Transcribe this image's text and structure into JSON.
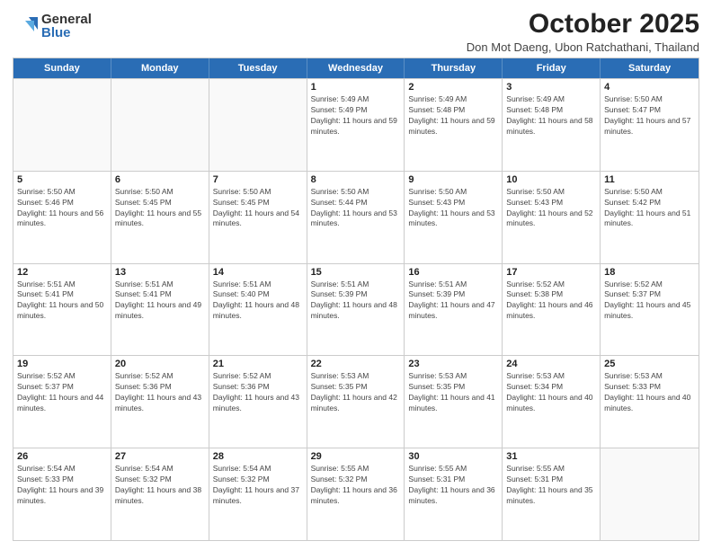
{
  "logo": {
    "general": "General",
    "blue": "Blue"
  },
  "title": "October 2025",
  "subtitle": "Don Mot Daeng, Ubon Ratchathani, Thailand",
  "days": [
    "Sunday",
    "Monday",
    "Tuesday",
    "Wednesday",
    "Thursday",
    "Friday",
    "Saturday"
  ],
  "rows": [
    [
      {
        "date": "",
        "empty": true
      },
      {
        "date": "",
        "empty": true
      },
      {
        "date": "",
        "empty": true
      },
      {
        "date": "1",
        "sunrise": "5:49 AM",
        "sunset": "5:49 PM",
        "daylight": "11 hours and 59 minutes."
      },
      {
        "date": "2",
        "sunrise": "5:49 AM",
        "sunset": "5:48 PM",
        "daylight": "11 hours and 59 minutes."
      },
      {
        "date": "3",
        "sunrise": "5:49 AM",
        "sunset": "5:48 PM",
        "daylight": "11 hours and 58 minutes."
      },
      {
        "date": "4",
        "sunrise": "5:50 AM",
        "sunset": "5:47 PM",
        "daylight": "11 hours and 57 minutes."
      }
    ],
    [
      {
        "date": "5",
        "sunrise": "5:50 AM",
        "sunset": "5:46 PM",
        "daylight": "11 hours and 56 minutes."
      },
      {
        "date": "6",
        "sunrise": "5:50 AM",
        "sunset": "5:45 PM",
        "daylight": "11 hours and 55 minutes."
      },
      {
        "date": "7",
        "sunrise": "5:50 AM",
        "sunset": "5:45 PM",
        "daylight": "11 hours and 54 minutes."
      },
      {
        "date": "8",
        "sunrise": "5:50 AM",
        "sunset": "5:44 PM",
        "daylight": "11 hours and 53 minutes."
      },
      {
        "date": "9",
        "sunrise": "5:50 AM",
        "sunset": "5:43 PM",
        "daylight": "11 hours and 53 minutes."
      },
      {
        "date": "10",
        "sunrise": "5:50 AM",
        "sunset": "5:43 PM",
        "daylight": "11 hours and 52 minutes."
      },
      {
        "date": "11",
        "sunrise": "5:50 AM",
        "sunset": "5:42 PM",
        "daylight": "11 hours and 51 minutes."
      }
    ],
    [
      {
        "date": "12",
        "sunrise": "5:51 AM",
        "sunset": "5:41 PM",
        "daylight": "11 hours and 50 minutes."
      },
      {
        "date": "13",
        "sunrise": "5:51 AM",
        "sunset": "5:41 PM",
        "daylight": "11 hours and 49 minutes."
      },
      {
        "date": "14",
        "sunrise": "5:51 AM",
        "sunset": "5:40 PM",
        "daylight": "11 hours and 48 minutes."
      },
      {
        "date": "15",
        "sunrise": "5:51 AM",
        "sunset": "5:39 PM",
        "daylight": "11 hours and 48 minutes."
      },
      {
        "date": "16",
        "sunrise": "5:51 AM",
        "sunset": "5:39 PM",
        "daylight": "11 hours and 47 minutes."
      },
      {
        "date": "17",
        "sunrise": "5:52 AM",
        "sunset": "5:38 PM",
        "daylight": "11 hours and 46 minutes."
      },
      {
        "date": "18",
        "sunrise": "5:52 AM",
        "sunset": "5:37 PM",
        "daylight": "11 hours and 45 minutes."
      }
    ],
    [
      {
        "date": "19",
        "sunrise": "5:52 AM",
        "sunset": "5:37 PM",
        "daylight": "11 hours and 44 minutes."
      },
      {
        "date": "20",
        "sunrise": "5:52 AM",
        "sunset": "5:36 PM",
        "daylight": "11 hours and 43 minutes."
      },
      {
        "date": "21",
        "sunrise": "5:52 AM",
        "sunset": "5:36 PM",
        "daylight": "11 hours and 43 minutes."
      },
      {
        "date": "22",
        "sunrise": "5:53 AM",
        "sunset": "5:35 PM",
        "daylight": "11 hours and 42 minutes."
      },
      {
        "date": "23",
        "sunrise": "5:53 AM",
        "sunset": "5:35 PM",
        "daylight": "11 hours and 41 minutes."
      },
      {
        "date": "24",
        "sunrise": "5:53 AM",
        "sunset": "5:34 PM",
        "daylight": "11 hours and 40 minutes."
      },
      {
        "date": "25",
        "sunrise": "5:53 AM",
        "sunset": "5:33 PM",
        "daylight": "11 hours and 40 minutes."
      }
    ],
    [
      {
        "date": "26",
        "sunrise": "5:54 AM",
        "sunset": "5:33 PM",
        "daylight": "11 hours and 39 minutes."
      },
      {
        "date": "27",
        "sunrise": "5:54 AM",
        "sunset": "5:32 PM",
        "daylight": "11 hours and 38 minutes."
      },
      {
        "date": "28",
        "sunrise": "5:54 AM",
        "sunset": "5:32 PM",
        "daylight": "11 hours and 37 minutes."
      },
      {
        "date": "29",
        "sunrise": "5:55 AM",
        "sunset": "5:32 PM",
        "daylight": "11 hours and 36 minutes."
      },
      {
        "date": "30",
        "sunrise": "5:55 AM",
        "sunset": "5:31 PM",
        "daylight": "11 hours and 36 minutes."
      },
      {
        "date": "31",
        "sunrise": "5:55 AM",
        "sunset": "5:31 PM",
        "daylight": "11 hours and 35 minutes."
      },
      {
        "date": "",
        "empty": true
      }
    ]
  ]
}
